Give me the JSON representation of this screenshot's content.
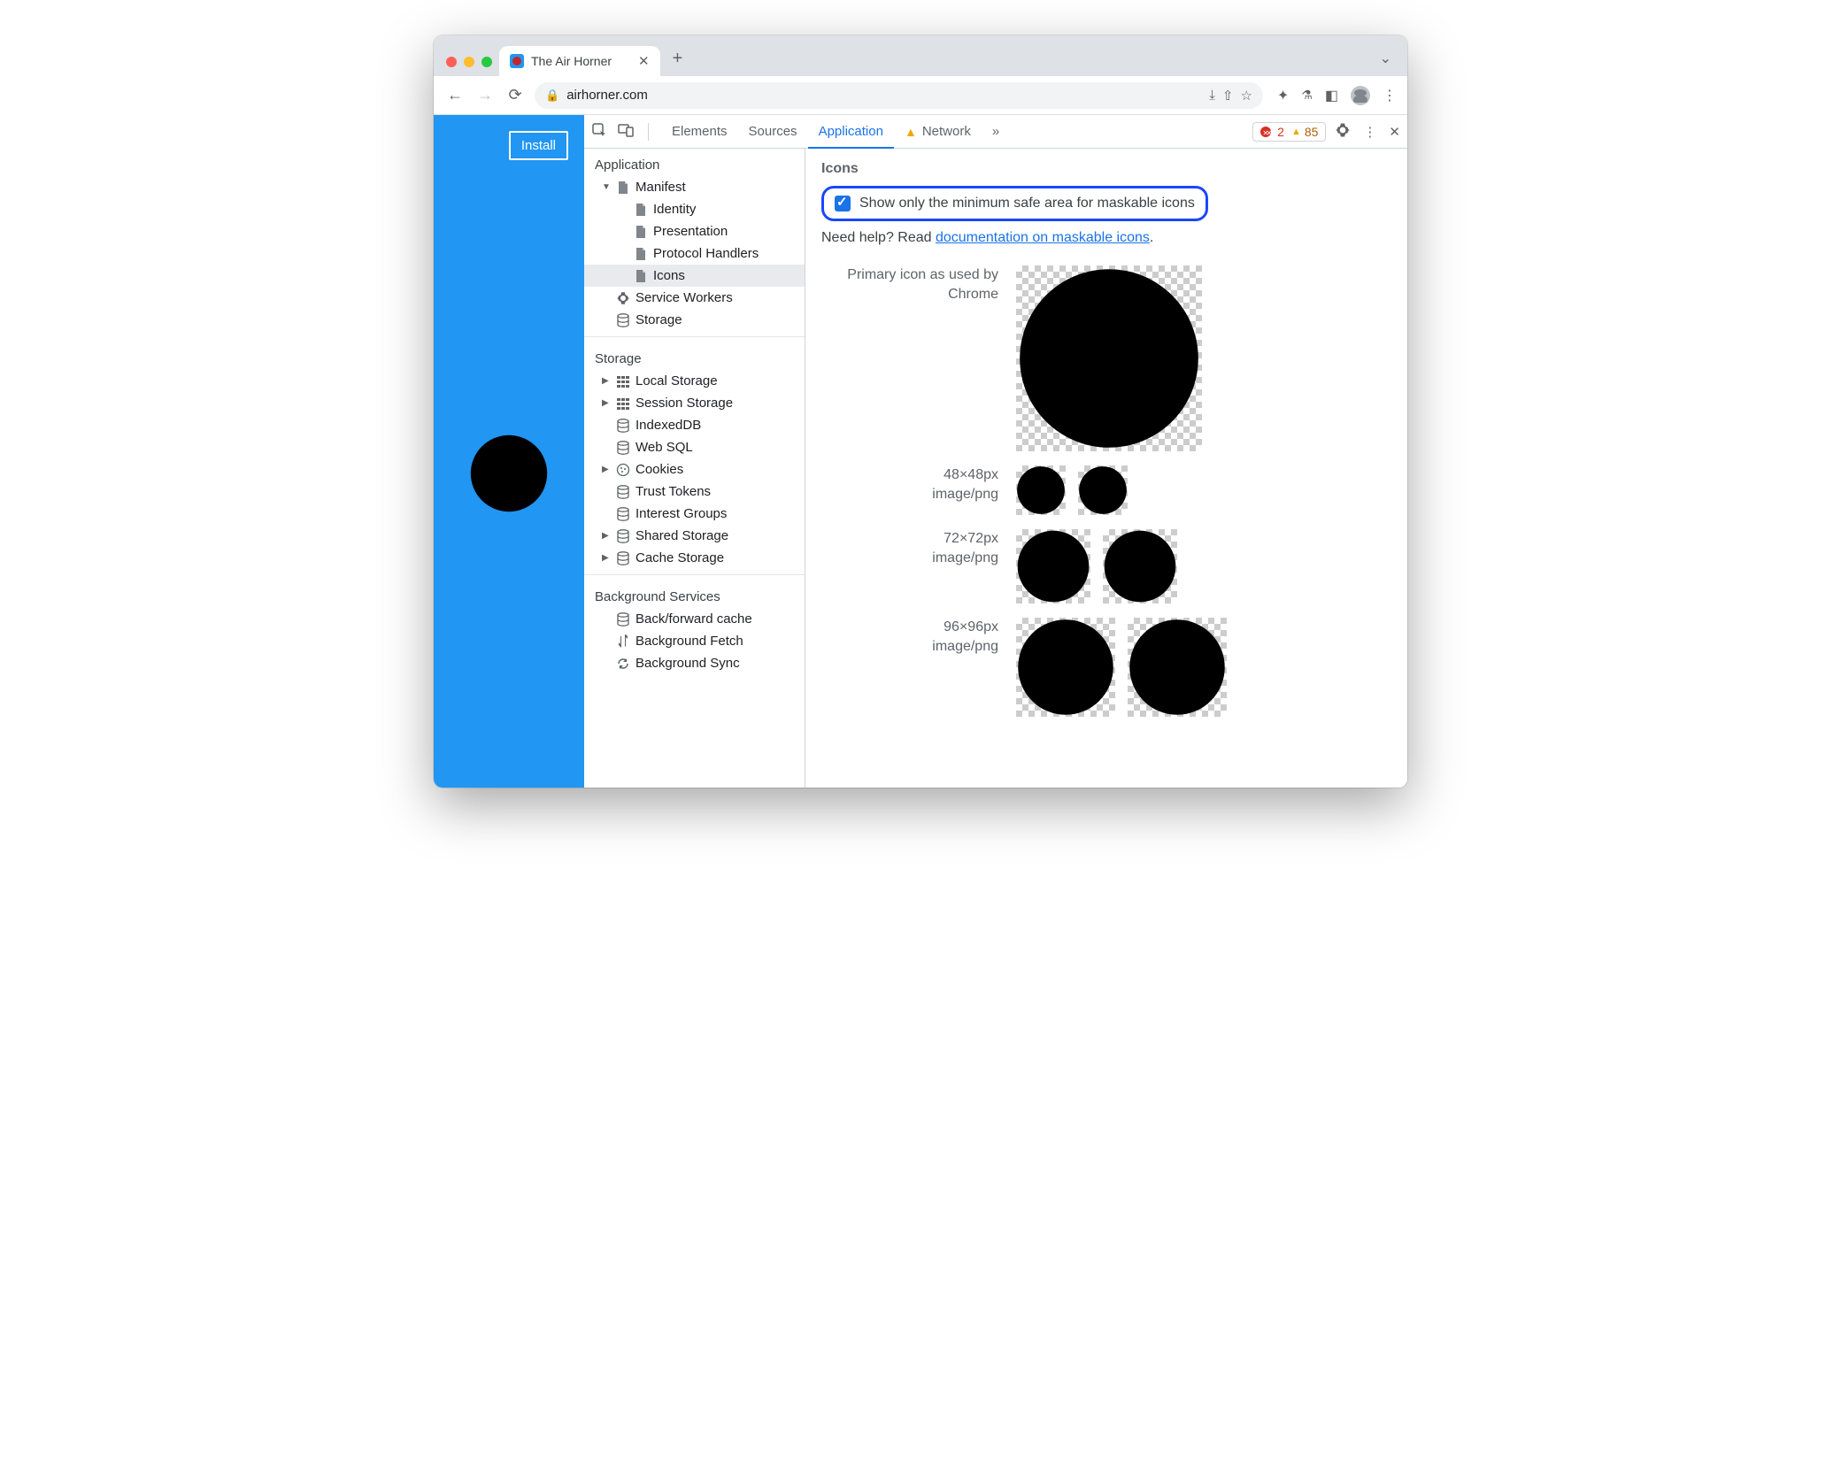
{
  "browser": {
    "tab_title": "The Air Horner",
    "url": "airhorner.com",
    "install_button": "Install"
  },
  "devtools": {
    "tabs": {
      "elements": "Elements",
      "sources": "Sources",
      "application": "Application",
      "network": "Network"
    },
    "active_tab": "Application",
    "errors": 2,
    "warnings": 85
  },
  "sidebar": {
    "application": {
      "heading": "Application",
      "manifest": "Manifest",
      "identity": "Identity",
      "presentation": "Presentation",
      "protocol_handlers": "Protocol Handlers",
      "icons": "Icons",
      "service_workers": "Service Workers",
      "storage": "Storage"
    },
    "storage": {
      "heading": "Storage",
      "local_storage": "Local Storage",
      "session_storage": "Session Storage",
      "indexeddb": "IndexedDB",
      "web_sql": "Web SQL",
      "cookies": "Cookies",
      "trust_tokens": "Trust Tokens",
      "interest_groups": "Interest Groups",
      "shared_storage": "Shared Storage",
      "cache_storage": "Cache Storage"
    },
    "background": {
      "heading": "Background Services",
      "bfcache": "Back/forward cache",
      "bg_fetch": "Background Fetch",
      "bg_sync": "Background Sync"
    }
  },
  "panel": {
    "heading": "Icons",
    "checkbox_label": "Show only the minimum safe area for maskable icons",
    "help_prefix": "Need help? Read ",
    "help_link_text": "documentation on maskable icons",
    "help_suffix": ".",
    "rows": {
      "primary_l1": "Primary icon as used by",
      "primary_l2": "Chrome",
      "r48_size": "48×48px",
      "r48_type": "image/png",
      "r72_size": "72×72px",
      "r72_type": "image/png",
      "r96_size": "96×96px",
      "r96_type": "image/png"
    }
  }
}
